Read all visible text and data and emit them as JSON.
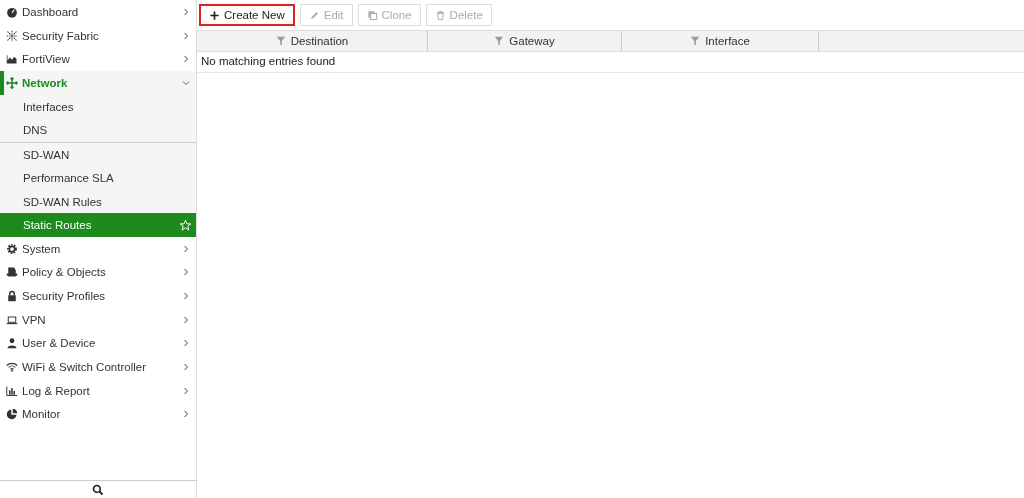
{
  "sidebar": {
    "items": [
      {
        "label": "Dashboard",
        "expanded": false
      },
      {
        "label": "Security Fabric",
        "expanded": false
      },
      {
        "label": "FortiView",
        "expanded": false
      },
      {
        "label": "Network",
        "expanded": true,
        "groups": [
          [
            {
              "label": "Interfaces",
              "selected": false
            },
            {
              "label": "DNS",
              "selected": false
            }
          ],
          [
            {
              "label": "SD-WAN",
              "selected": false
            },
            {
              "label": "Performance SLA",
              "selected": false
            },
            {
              "label": "SD-WAN Rules",
              "selected": false
            },
            {
              "label": "Static Routes",
              "selected": true
            }
          ]
        ]
      },
      {
        "label": "System",
        "expanded": false
      },
      {
        "label": "Policy & Objects",
        "expanded": false
      },
      {
        "label": "Security Profiles",
        "expanded": false
      },
      {
        "label": "VPN",
        "expanded": false
      },
      {
        "label": "User & Device",
        "expanded": false
      },
      {
        "label": "WiFi & Switch Controller",
        "expanded": false
      },
      {
        "label": "Log & Report",
        "expanded": false
      },
      {
        "label": "Monitor",
        "expanded": false
      }
    ]
  },
  "toolbar": [
    {
      "label": "Create New",
      "disabled": false,
      "highlighted": true
    },
    {
      "label": "Edit",
      "disabled": true,
      "highlighted": false
    },
    {
      "label": "Clone",
      "disabled": true,
      "highlighted": false
    },
    {
      "label": "Delete",
      "disabled": true,
      "highlighted": false
    }
  ],
  "table": {
    "columns": [
      "Destination",
      "Gateway",
      "Interface"
    ],
    "empty_message": "No matching entries found"
  }
}
